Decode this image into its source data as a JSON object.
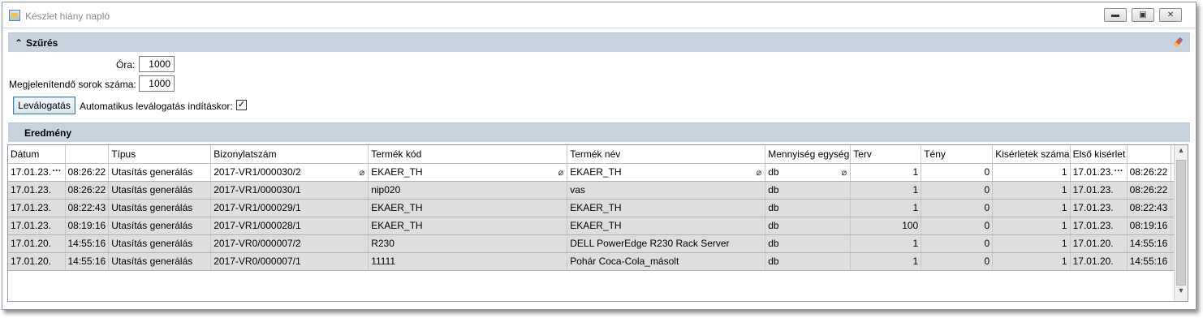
{
  "window": {
    "title": "Készlet hiány napló",
    "minimize_icon": "minimize-icon",
    "maximize_icon": "maximize-icon",
    "close_icon": "close-icon"
  },
  "filter_section": {
    "title": "Szűrés",
    "collapse_icon": "chevron-up-icon",
    "eraser_icon": "eraser-icon",
    "hours_label": "Óra:",
    "hours_value": "1000",
    "rows_label": "Megjelenítendő sorok száma:",
    "rows_value": "1000",
    "filter_button": "Leválogatás",
    "auto_filter_label": "Automatikus leválogatás indításkor:",
    "auto_filter_checked": true
  },
  "result_section": {
    "title": "Eredmény"
  },
  "grid": {
    "columns": [
      "Dátum",
      "",
      "Típus",
      "Bizonylatszám",
      "Termék kód",
      "Termék név",
      "Mennyiség egység",
      "Terv",
      "Tény",
      "Kisérletek száma",
      "Első kisérlet",
      ""
    ],
    "rows": [
      [
        "17.01.23.",
        "08:26:22",
        "Utasítás generálás",
        "2017-VR1/000030/2",
        "EKAER_TH",
        "EKAER_TH",
        "db",
        "1",
        "0",
        "1",
        "17.01.23.",
        "08:26:22"
      ],
      [
        "17.01.23.",
        "08:26:22",
        "Utasítás generálás",
        "2017-VR1/000030/1",
        "nip020",
        "vas",
        "db",
        "1",
        "0",
        "1",
        "17.01.23.",
        "08:26:22"
      ],
      [
        "17.01.23.",
        "08:22:43",
        "Utasítás generálás",
        "2017-VR1/000029/1",
        "EKAER_TH",
        "EKAER_TH",
        "db",
        "1",
        "0",
        "1",
        "17.01.23.",
        "08:22:43"
      ],
      [
        "17.01.23.",
        "08:19:16",
        "Utasítás generálás",
        "2017-VR1/000028/1",
        "EKAER_TH",
        "EKAER_TH",
        "db",
        "100",
        "0",
        "1",
        "17.01.23.",
        "08:19:16"
      ],
      [
        "17.01.20.",
        "14:55:16",
        "Utasítás generálás",
        "2017-VR0/000007/2",
        "R230",
        "DELL PowerEdge R230 Rack Server",
        "db",
        "1",
        "0",
        "1",
        "17.01.20.",
        "14:55:16"
      ],
      [
        "17.01.20.",
        "14:55:16",
        "Utasítás generálás",
        "2017-VR0/000007/1",
        "11111",
        "Pohár Coca-Cola_másolt",
        "db",
        "1",
        "0",
        "1",
        "17.01.20.",
        "14:55:16"
      ]
    ],
    "selected_row": 0,
    "ellipsis": "···",
    "attachment_icon": "paperclip-icon"
  }
}
